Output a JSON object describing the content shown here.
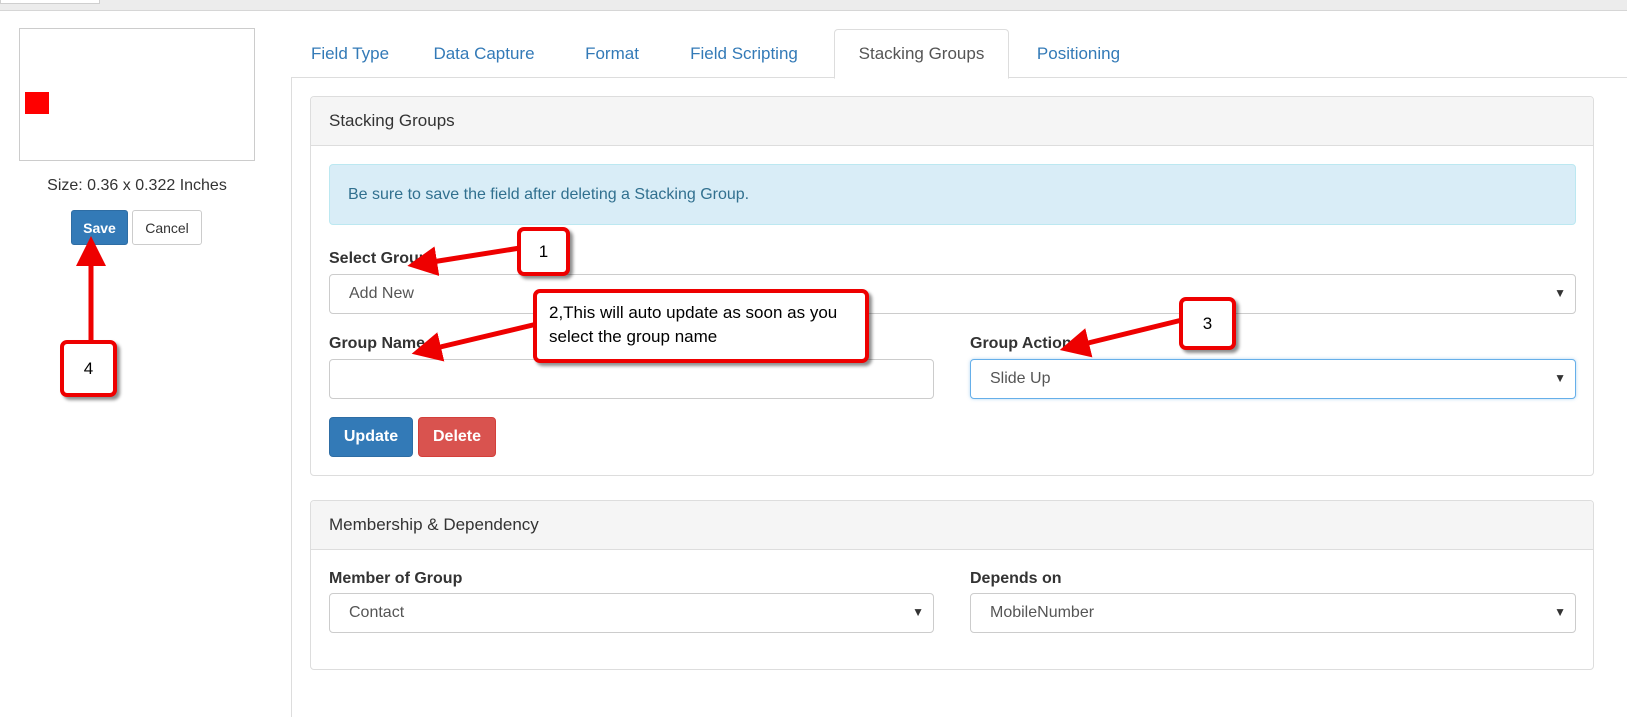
{
  "preview": {
    "size_text": "Size: 0.36 x 0.322 Inches",
    "save_label": "Save",
    "cancel_label": "Cancel",
    "mark_color": "#ff0000"
  },
  "tabs": [
    {
      "label": "Field Type",
      "active": false
    },
    {
      "label": "Data Capture",
      "active": false
    },
    {
      "label": "Format",
      "active": false
    },
    {
      "label": "Field Scripting",
      "active": false
    },
    {
      "label": "Stacking Groups",
      "active": true
    },
    {
      "label": "Positioning",
      "active": false
    }
  ],
  "stacking_panel": {
    "heading": "Stacking Groups",
    "alert": "Be sure to save the field after deleting a Stacking Group.",
    "select_group_label": "Select Group",
    "select_group_value": "Add New",
    "group_name_label": "Group Name",
    "group_name_value": "",
    "group_action_label": "Group Action",
    "group_action_value": "Slide Up",
    "update_label": "Update",
    "delete_label": "Delete"
  },
  "membership_panel": {
    "heading": "Membership & Dependency",
    "member_label": "Member of Group",
    "member_value": "Contact",
    "depends_label": "Depends on",
    "depends_value": "MobileNumber"
  },
  "annotations": {
    "c1": "1",
    "c2_line1": "2,This will auto update as soon as you",
    "c2_line2": "select the group name",
    "c3": "3",
    "c4": "4",
    "arrow_color": "#ee0000"
  },
  "colors": {
    "primary": "#337ab7",
    "danger": "#d9534f",
    "alert_bg": "#d9edf7",
    "alert_text": "#31708f"
  }
}
